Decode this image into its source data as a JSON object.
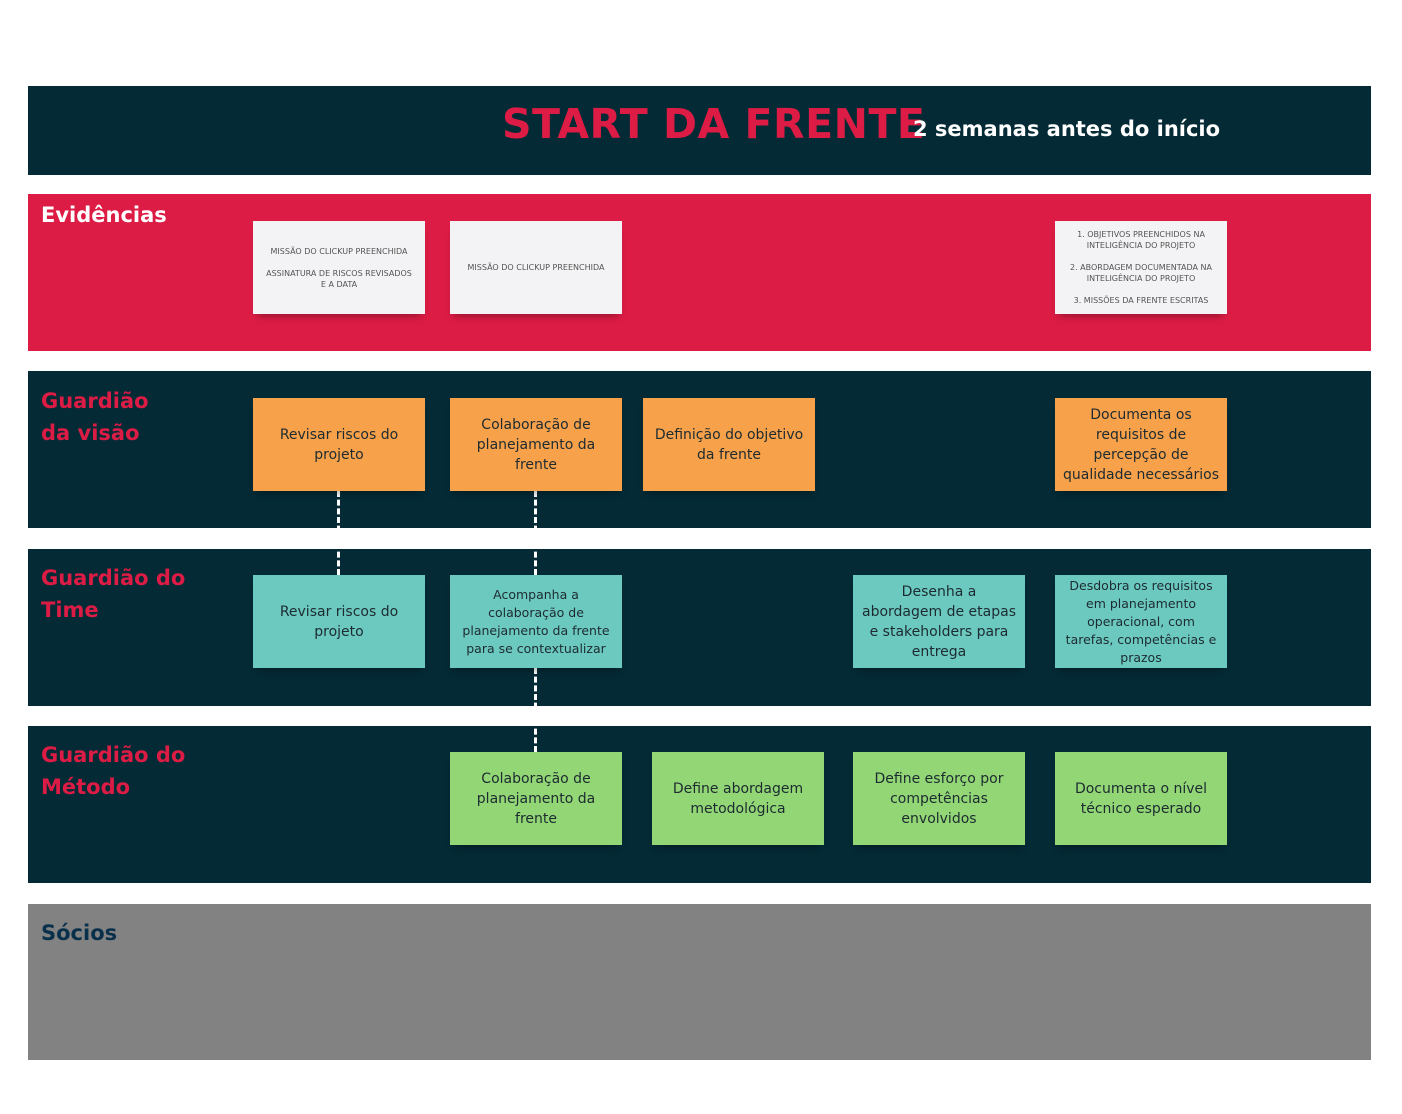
{
  "header": {
    "title": "START DA FRENTE",
    "subtitle": "2 semanas antes do início"
  },
  "lanes": {
    "evidencias": {
      "label": "Evidências",
      "notes": [
        "MISSÃO DO CLICKUP PREENCHIDA\n\nASSINATURA DE RISCOS REVISADOS E A DATA",
        "MISSÃO DO CLICKUP PREENCHIDA",
        "1. OBJETIVOS PREENCHIDOS NA INTELIGÊNCIA DO PROJETO\n\n2. ABORDAGEM DOCUMENTADA NA INTELIGÊNCIA DO PROJETO\n\n3. MISSÕES DA FRENTE ESCRITAS"
      ]
    },
    "visao": {
      "label": "Guardião\nda visão",
      "notes": [
        "Revisar riscos do projeto",
        "Colaboração de planejamento da frente",
        "Definição do objetivo da frente",
        "Documenta os requisitos de percepção de qualidade necessários"
      ]
    },
    "time": {
      "label": "Guardião do\nTime",
      "notes": [
        "Revisar riscos do projeto",
        "Acompanha a colaboração de planejamento da frente para se contextualizar",
        "Desenha a abordagem de etapas e stakeholders para entrega",
        "Desdobra os requisitos em planejamento operacional, com tarefas, competências e prazos"
      ]
    },
    "metodo": {
      "label": "Guardião do\nMétodo",
      "notes": [
        "Colaboração de planejamento da frente",
        "Define abordagem metodológica",
        "Define esforço por competências envolvidos",
        "Documenta o nível técnico esperado"
      ]
    },
    "socios": {
      "label": "Sócios"
    }
  },
  "colors": {
    "dark_band": "#042a35",
    "evidence_band": "#dd1c45",
    "partners_band": "#828282",
    "vision_notes": "#f7a14b",
    "team_notes": "#6cc9c0",
    "method_notes": "#92d676",
    "evidence_notes": "#f3f2f4"
  }
}
